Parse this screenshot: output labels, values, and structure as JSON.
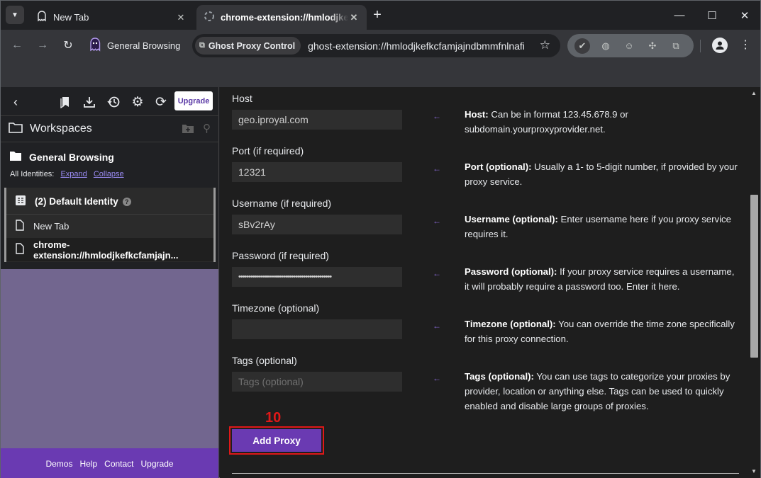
{
  "tabs": [
    {
      "title": "New Tab",
      "close": "✕"
    },
    {
      "title": "chrome-extension://hmlodjkefkcfamjajndbmmfnlnafi",
      "close": "✕"
    }
  ],
  "window": {
    "new_tab": "+",
    "minimize": "—",
    "maximize": "☐",
    "close": "✕"
  },
  "toolbar": {
    "profile_name": "General Browsing",
    "omni_chip": "Ghost Proxy Control",
    "url": "ghost-extension://hmlodjkefkcfamjajndbmmfnlnafi"
  },
  "sidebar": {
    "upgrade": "Upgrade",
    "workspaces_title": "Workspaces",
    "workspace_name": "General Browsing",
    "all_identities": "All Identities:",
    "expand": "Expand",
    "collapse": "Collapse",
    "identity_title": "(2) Default Identity",
    "identity_help": "?",
    "tab_items": [
      "New Tab",
      "chrome-extension://hmlodjkefkcfamjajn..."
    ],
    "footer": [
      "Demos",
      "Help",
      "Contact",
      "Upgrade"
    ]
  },
  "form": {
    "host": {
      "label": "Host",
      "value": "geo.iproyal.com"
    },
    "port": {
      "label": "Port (if required)",
      "value": "12321"
    },
    "username": {
      "label": "Username (if required)",
      "value": "sBv2rAy"
    },
    "password": {
      "label": "Password (if required)",
      "value": "••••••••••••••••••••••••••••••••••••••••••••••"
    },
    "timezone": {
      "label": "Timezone (optional)",
      "value": ""
    },
    "tags": {
      "label": "Tags (optional)",
      "placeholder": "Tags (optional)"
    }
  },
  "help": [
    {
      "bold": "Host:",
      "text": " Can be in format 123.45.678.9 or subdomain.yourproxyprovider.net."
    },
    {
      "bold": "Port (optional):",
      "text": " Usually a 1- to 5-digit number, if provided by your proxy service."
    },
    {
      "bold": "Username (optional):",
      "text": " Enter username here if you proxy service requires it."
    },
    {
      "bold": "Password (optional):",
      "text": " If your proxy service requires a username, it will probably require a password too. Enter it here."
    },
    {
      "bold": "Timezone (optional):",
      "text": " You can override the time zone specifically for this proxy connection."
    },
    {
      "bold": "Tags (optional):",
      "text": " You can use tags to categorize your proxies by provider, location or anything else. Tags can be used to quickly enabled and disable large groups of proxies."
    }
  ],
  "arrow_glyph": "←",
  "step_number": "10",
  "add_proxy": "Add Proxy",
  "colors": {
    "accent": "#6a3ab2",
    "highlight": "#e01818",
    "sidebar_fill": "#72668f"
  }
}
